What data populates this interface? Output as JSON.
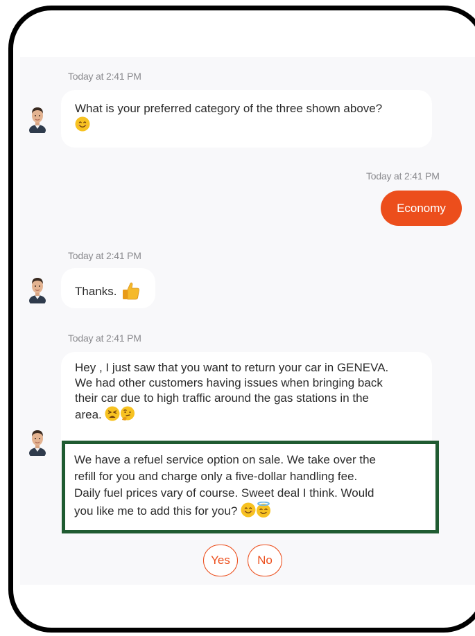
{
  "messages": [
    {
      "timestamp": "Today at 2:41 PM",
      "text": "What is your preferred category of the three shown above?",
      "emojis": [
        "smile"
      ]
    },
    {
      "timestamp": "Today at 2:41 PM",
      "text": "Economy",
      "from": "user"
    },
    {
      "timestamp": "Today at 2:41 PM",
      "text": "Thanks.",
      "emojis": [
        "thumbs-up"
      ]
    },
    {
      "timestamp": "Today at 2:41 PM",
      "line1": "Hey , I just saw that you want to return your car in GENEVA.",
      "line2": "We had other customers having issues when bringing back",
      "line3": "their car due to high traffic around the gas stations in the",
      "line4": "area.",
      "emojis": [
        "tired-face",
        "thinking-face"
      ]
    },
    {
      "line1": "We have a refuel service option on sale. We take over the",
      "line2": "refill for you and charge only a five-dollar handling fee.",
      "line3": "Daily fuel prices vary of course. Sweet deal I think. Would",
      "line4": "you like me to add this for you?",
      "emojis": [
        "smile",
        "halo"
      ]
    }
  ],
  "quick_replies": [
    "Yes",
    "No"
  ],
  "colors": {
    "accent": "#ec4e1c",
    "highlight_border": "#1f5b31",
    "chat_background": "#f8f8fa"
  }
}
